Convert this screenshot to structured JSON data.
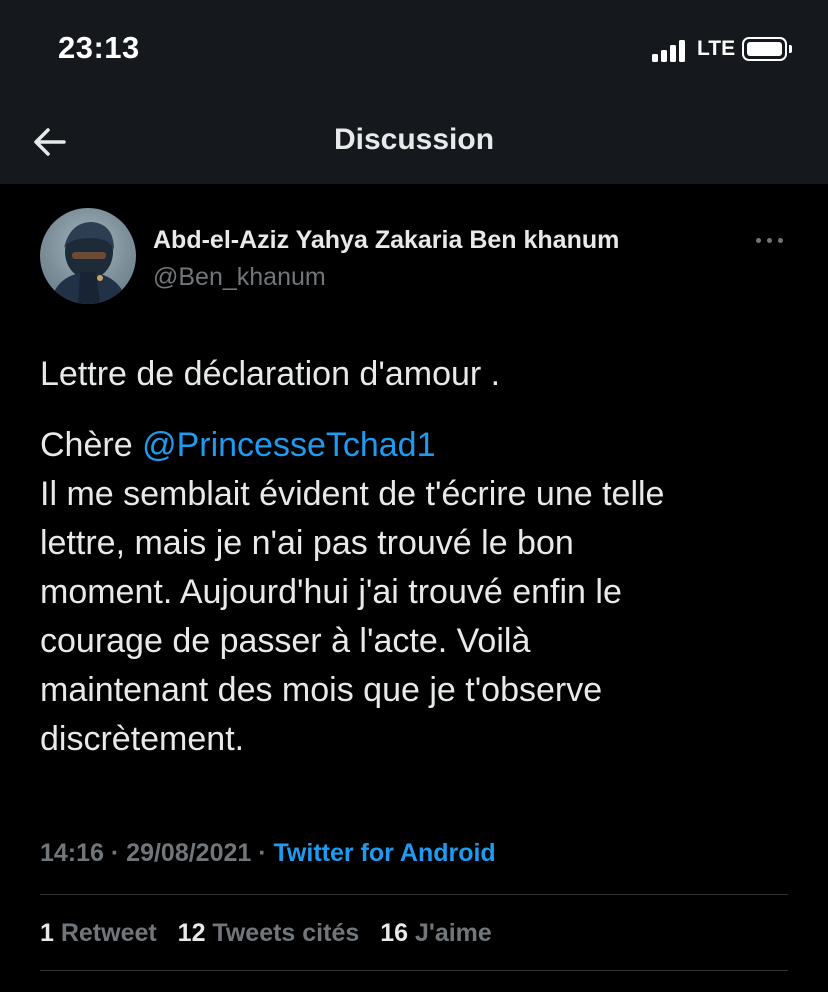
{
  "status_bar": {
    "time": "23:13",
    "network": "LTE"
  },
  "header": {
    "title": "Discussion",
    "back_icon": "arrow-left-icon"
  },
  "tweet": {
    "author": {
      "display_name": "Abd-el-Aziz Yahya Zakaria Ben khanum",
      "handle": "@Ben_khanum"
    },
    "more_icon": "more-horizontal-icon",
    "title_line": "Lettre de déclaration d'amour .",
    "salutation": "Chère ",
    "mention": "@PrincesseTchad1",
    "body_lines": [
      "Il me semblait évident de t'écrire une telle",
      "lettre, mais je n'ai pas trouvé le bon",
      "moment. Aujourd'hui j'ai trouvé enfin le",
      "courage de passer à l'acte.  Voilà",
      "maintenant des mois que je t'observe",
      "discrètement."
    ],
    "time": "14:16",
    "date": "29/08/2021",
    "separator": " · ",
    "source": "Twitter for Android"
  },
  "stats": {
    "retweets_count": "1",
    "retweets_label": " Retweet",
    "quotes_count": "12",
    "quotes_label": " Tweets cités",
    "likes_count": "16",
    "likes_label": " J'aime"
  },
  "colors": {
    "background": "#000000",
    "header_bg": "#15181c",
    "text_primary": "#e7e9ea",
    "text_secondary": "#71767b",
    "accent": "#1d9bf0",
    "divider": "#2f3336"
  }
}
